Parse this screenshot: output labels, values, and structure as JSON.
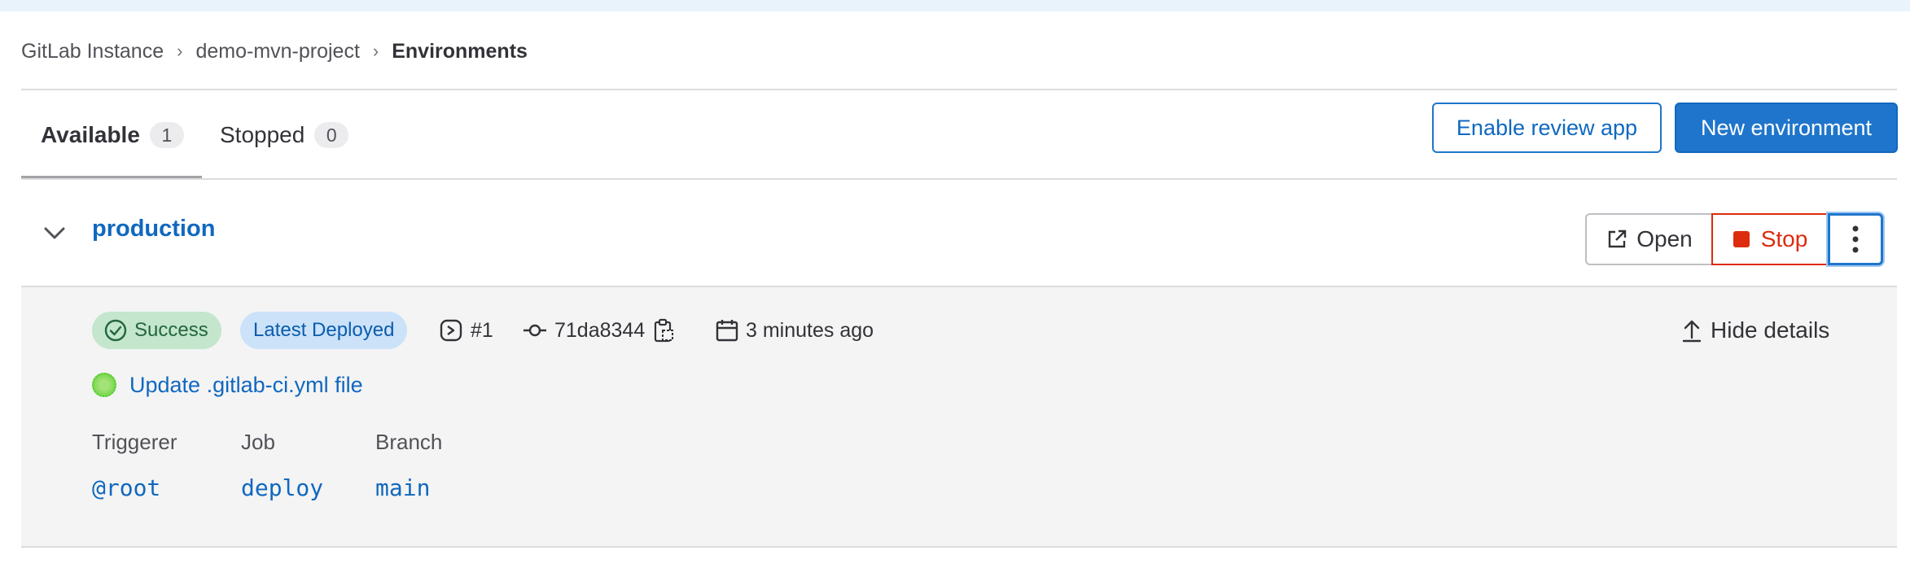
{
  "breadcrumb": {
    "items": [
      "GitLab Instance",
      "demo-mvn-project"
    ],
    "current": "Environments"
  },
  "tabs": [
    {
      "label": "Available",
      "count": "1"
    },
    {
      "label": "Stopped",
      "count": "0"
    }
  ],
  "actions": {
    "enable_review_app": "Enable review app",
    "new_environment": "New environment"
  },
  "environment": {
    "name": "production",
    "open_label": "Open",
    "stop_label": "Stop",
    "status": "Success",
    "latest_badge": "Latest Deployed",
    "deployment_id": "#1",
    "commit_sha": "71da8344",
    "time": "3 minutes ago",
    "hide_details": "Hide details",
    "commit_title": "Update .gitlab-ci.yml file",
    "details": {
      "headers": [
        "Triggerer",
        "Job",
        "Branch"
      ],
      "values": [
        "@root",
        "deploy",
        "main"
      ]
    }
  },
  "colors": {
    "accent": "#1f75cb",
    "danger": "#dd2b0e",
    "success_bg": "#c3e6cd",
    "info_bg": "#cbe2f9"
  }
}
